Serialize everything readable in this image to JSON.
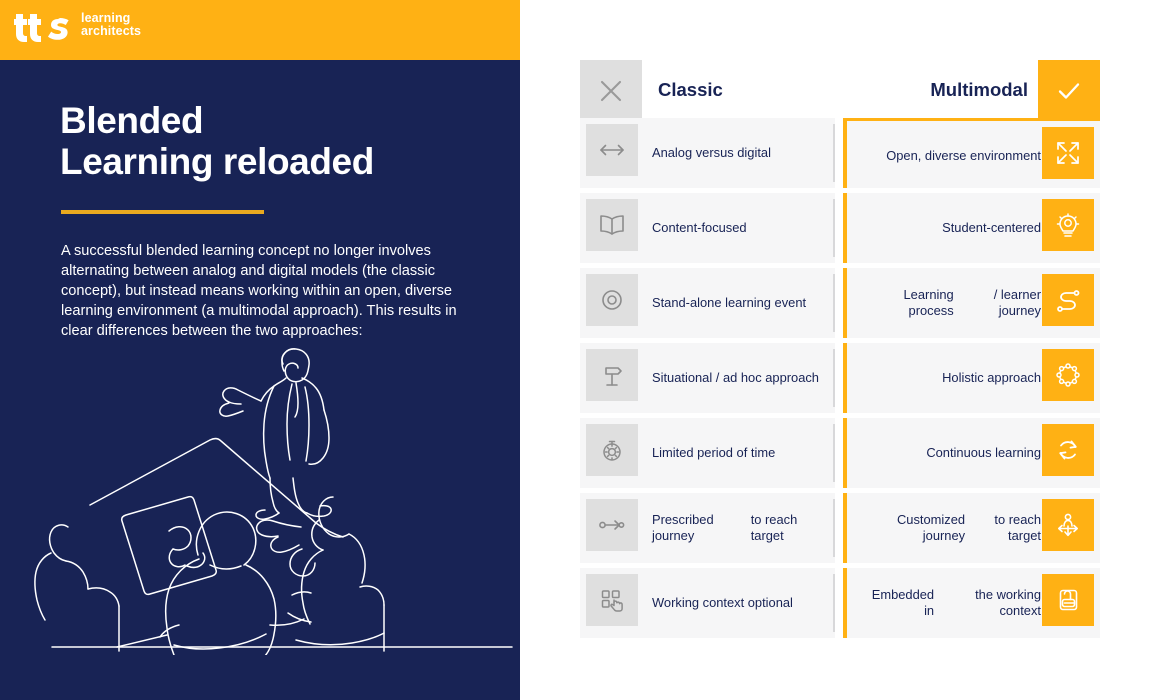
{
  "brand": {
    "logo_mark": "tts-logo",
    "line1": "learning",
    "line2": "architects",
    "bar_color": "#ffb114"
  },
  "hero": {
    "title_line1": "Blended",
    "title_line2": "Learning reloaded",
    "rule_color": "#e9a91f",
    "paragraph": "A successful blended learning concept no longer involves alternating between analog and digital models (the classic concept), but instead means working within an open, diverse learning environment (a multimodal approach). This results in clear differences between the two approaches:",
    "background_color": "#182355",
    "illustration": "line-art-presenter-and-audience"
  },
  "comparison": {
    "header": {
      "negative_icon": "close-x-icon",
      "positive_icon": "check-icon",
      "left_label": "Classic",
      "right_label": "Multimodal",
      "negative_box_color": "#dfdfdf",
      "positive_box_color": "#ffb114"
    },
    "rows": [
      {
        "left_icon": "arrows-left-right-icon",
        "left_label": "Analog versus digital",
        "right_icon": "expand-arrows-icon",
        "right_label": "Open, diverse environment",
        "highlighted": true
      },
      {
        "left_icon": "open-book-icon",
        "left_label": "Content-focused",
        "right_icon": "lightbulb-gear-icon",
        "right_label": "Student-centered",
        "highlighted": false
      },
      {
        "left_icon": "target-circle-icon",
        "left_label": "Stand-alone learning event",
        "right_icon": "path-route-icon",
        "right_label_line1": "Learning process",
        "right_label_line2": "/ learner journey",
        "highlighted": false
      },
      {
        "left_icon": "signpost-icon",
        "left_label": "Situational / ad hoc approach",
        "right_icon": "network-ring-icon",
        "right_label": "Holistic approach",
        "highlighted": false
      },
      {
        "left_icon": "stopwatch-icon",
        "left_label": "Limited period of time",
        "right_icon": "refresh-cycle-icon",
        "right_label": "Continuous learning",
        "highlighted": false
      },
      {
        "left_icon": "linear-path-icon",
        "left_label_line1": "Prescribed journey",
        "left_label_line2": "to reach target",
        "right_icon": "person-four-arrows-icon",
        "right_label_line1": "Customized journey",
        "right_label_line2": "to reach target",
        "highlighted": false
      },
      {
        "left_icon": "select-tap-icon",
        "left_label": "Working context optional",
        "right_icon": "document-embedded-icon",
        "right_label_line1": "Embedded in",
        "right_label_line2": "the working context",
        "highlighted": false
      }
    ]
  },
  "colors": {
    "navy": "#182355",
    "amber": "#ffb114",
    "row_background": "#f6f6f7",
    "left_icon_background": "#dfdfdf"
  }
}
